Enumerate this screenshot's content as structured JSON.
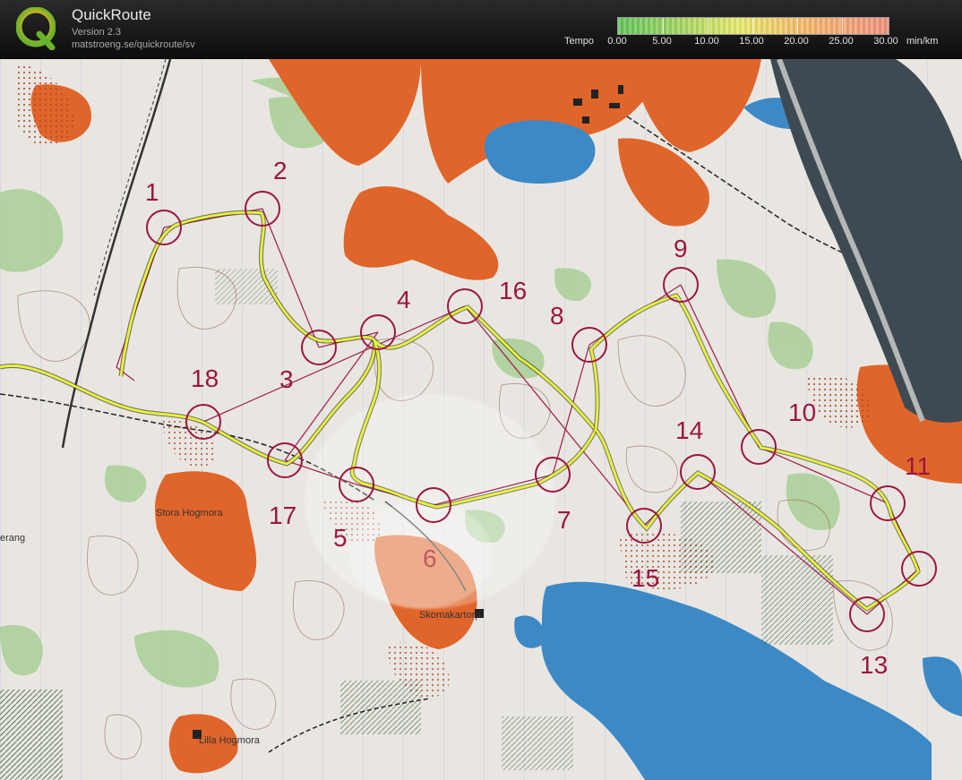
{
  "app": {
    "title": "QuickRoute",
    "version": "Version 2.3",
    "url": "matstroeng.se/quickroute/sv"
  },
  "tempo_legend": {
    "label": "Tempo",
    "ticks": [
      "0.00",
      "5.00",
      "10.00",
      "15.00",
      "20.00",
      "25.00",
      "30.00"
    ],
    "unit": "min/km",
    "colors": [
      "#5fc35a",
      "#9fd35f",
      "#e6ea6a",
      "#f3b96a",
      "#f08f7e"
    ]
  },
  "map": {
    "controls": [
      "1",
      "2",
      "3",
      "4",
      "5",
      "6",
      "7",
      "8",
      "9",
      "10",
      "11",
      "13",
      "14",
      "15",
      "16",
      "17",
      "18"
    ],
    "place_names": [
      "Stora Hogmora",
      "Skomakartorp",
      "Lilla Hogmora",
      "erang"
    ],
    "colors": {
      "route": "#e8f23a",
      "control": "#9b1640",
      "open_land": "#e36a2a",
      "water": "#3b86c4",
      "forest_green": "#9fc98a",
      "paper": "#e9e6e2"
    }
  }
}
